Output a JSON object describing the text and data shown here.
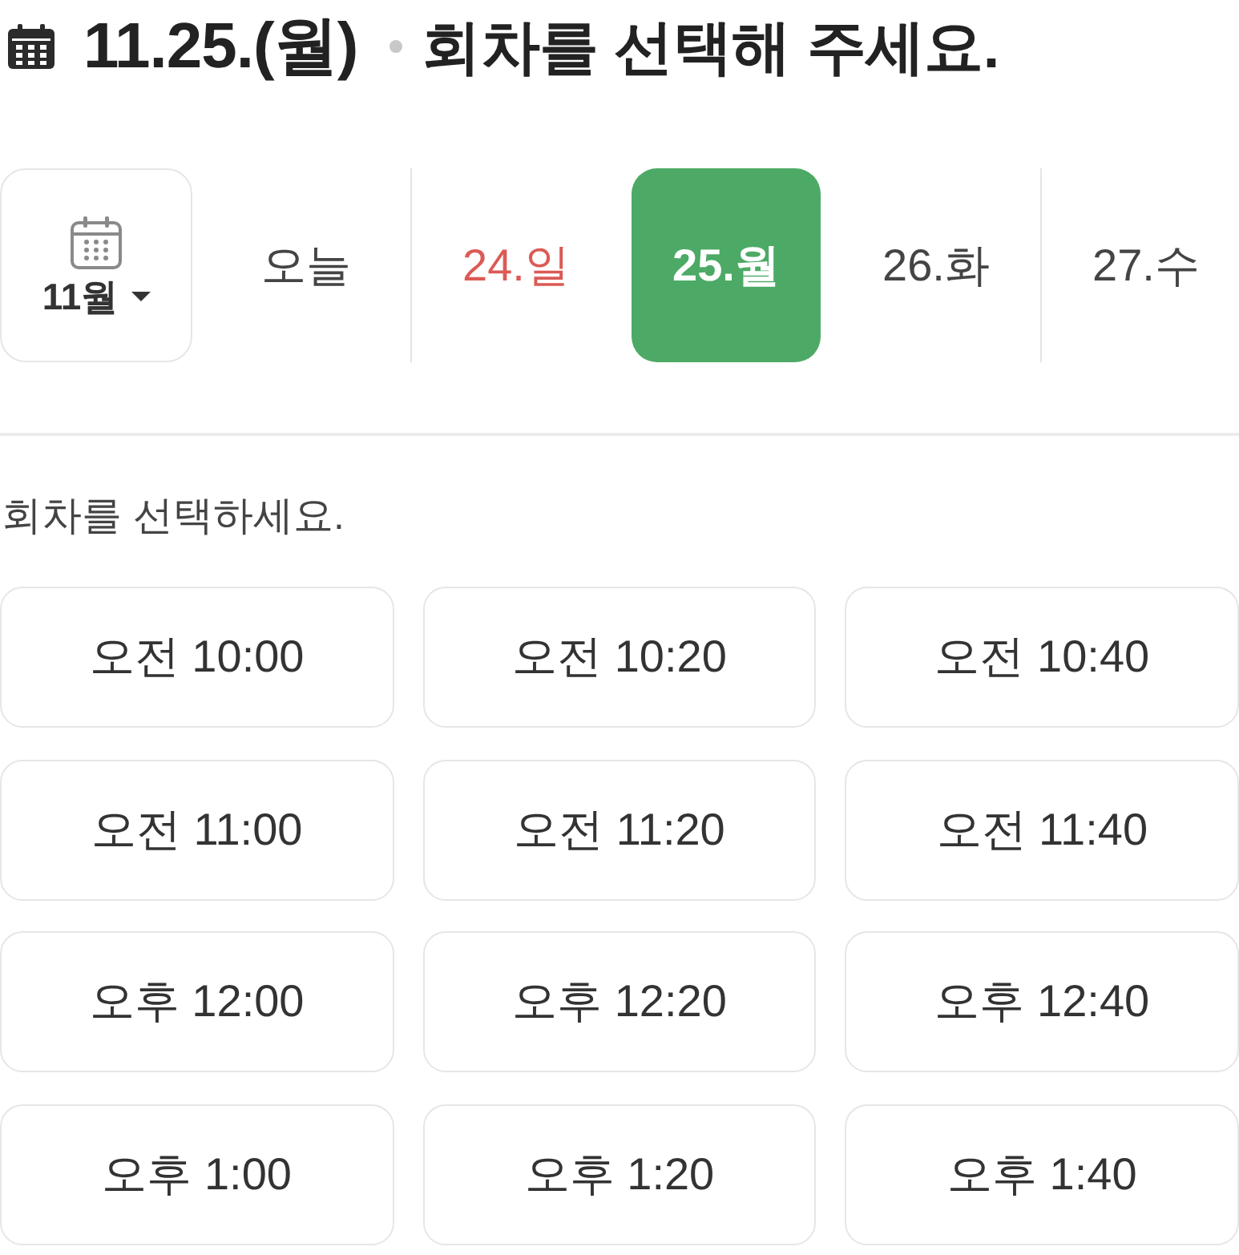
{
  "header": {
    "date": "11.25.(월)",
    "prompt": "회차를 선택해 주세요."
  },
  "date_bar": {
    "month_picker": {
      "label": "11월"
    },
    "dates": [
      {
        "label": "오늘",
        "selected": false,
        "holiday": false
      },
      {
        "label": "24.일",
        "selected": false,
        "holiday": true
      },
      {
        "label": "25.월",
        "selected": true,
        "holiday": false
      },
      {
        "label": "26.화",
        "selected": false,
        "holiday": false
      },
      {
        "label": "27.수",
        "selected": false,
        "holiday": false
      }
    ]
  },
  "session_section": {
    "label": "회차를 선택하세요.",
    "sessions": [
      {
        "label": "오전 10:00",
        "selected": false
      },
      {
        "label": "오전 10:20",
        "selected": false
      },
      {
        "label": "오전 10:40",
        "selected": false
      },
      {
        "label": "오전 11:00",
        "selected": false
      },
      {
        "label": "오전 11:20",
        "selected": false
      },
      {
        "label": "오전 11:40",
        "selected": false
      },
      {
        "label": "오후 12:00",
        "selected": false
      },
      {
        "label": "오후 12:20",
        "selected": false
      },
      {
        "label": "오후 12:40",
        "selected": false
      },
      {
        "label": "오후 1:00",
        "selected": false
      },
      {
        "label": "오후 1:20",
        "selected": false
      },
      {
        "label": "오후 1:40",
        "selected": false
      }
    ]
  }
}
